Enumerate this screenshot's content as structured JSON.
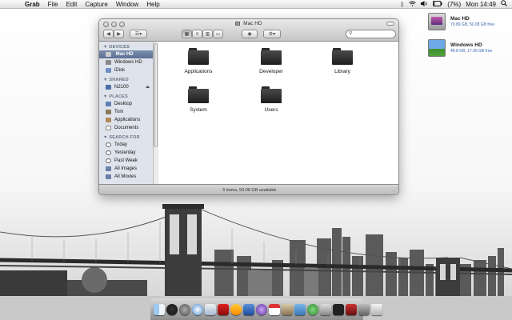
{
  "menubar": {
    "app_name": "Grab",
    "menus": [
      "File",
      "Edit",
      "Capture",
      "Window",
      "Help"
    ],
    "battery_percent": "(7%)",
    "clock": "Mon 14:49"
  },
  "desktop": {
    "icons": [
      {
        "label": "Mac HD",
        "detail": "79.89 GB, 50.08 GB free",
        "icon": "harddrive-icon"
      },
      {
        "label": "Windows HD",
        "detail": "48.8 GB, 17.99 GB free",
        "icon": "windows-drive-icon"
      }
    ]
  },
  "window": {
    "title": "Mac HD",
    "search_placeholder": "",
    "sidebar": {
      "sections": [
        {
          "heading": "DEVICES",
          "items": [
            {
              "label": "Mac HD",
              "selected": true
            },
            {
              "label": "Windows HD"
            },
            {
              "label": "iDisk"
            }
          ]
        },
        {
          "heading": "SHARED",
          "items": [
            {
              "label": "N2100"
            }
          ]
        },
        {
          "heading": "PLACES",
          "items": [
            {
              "label": "Desktop"
            },
            {
              "label": "Tom"
            },
            {
              "label": "Applications"
            },
            {
              "label": "Documents"
            }
          ]
        },
        {
          "heading": "SEARCH FOR",
          "items": [
            {
              "label": "Today"
            },
            {
              "label": "Yesterday"
            },
            {
              "label": "Past Week"
            },
            {
              "label": "All Images"
            },
            {
              "label": "All Movies"
            }
          ]
        }
      ]
    },
    "folders": [
      "Applications",
      "Developer",
      "Library",
      "System",
      "Users"
    ],
    "status": "5 items, 50.08 GB available"
  },
  "colors": {
    "selection": "#5a6f93",
    "sidebar_bg": "#dfe4ec",
    "folder": "#2a2a2a"
  }
}
